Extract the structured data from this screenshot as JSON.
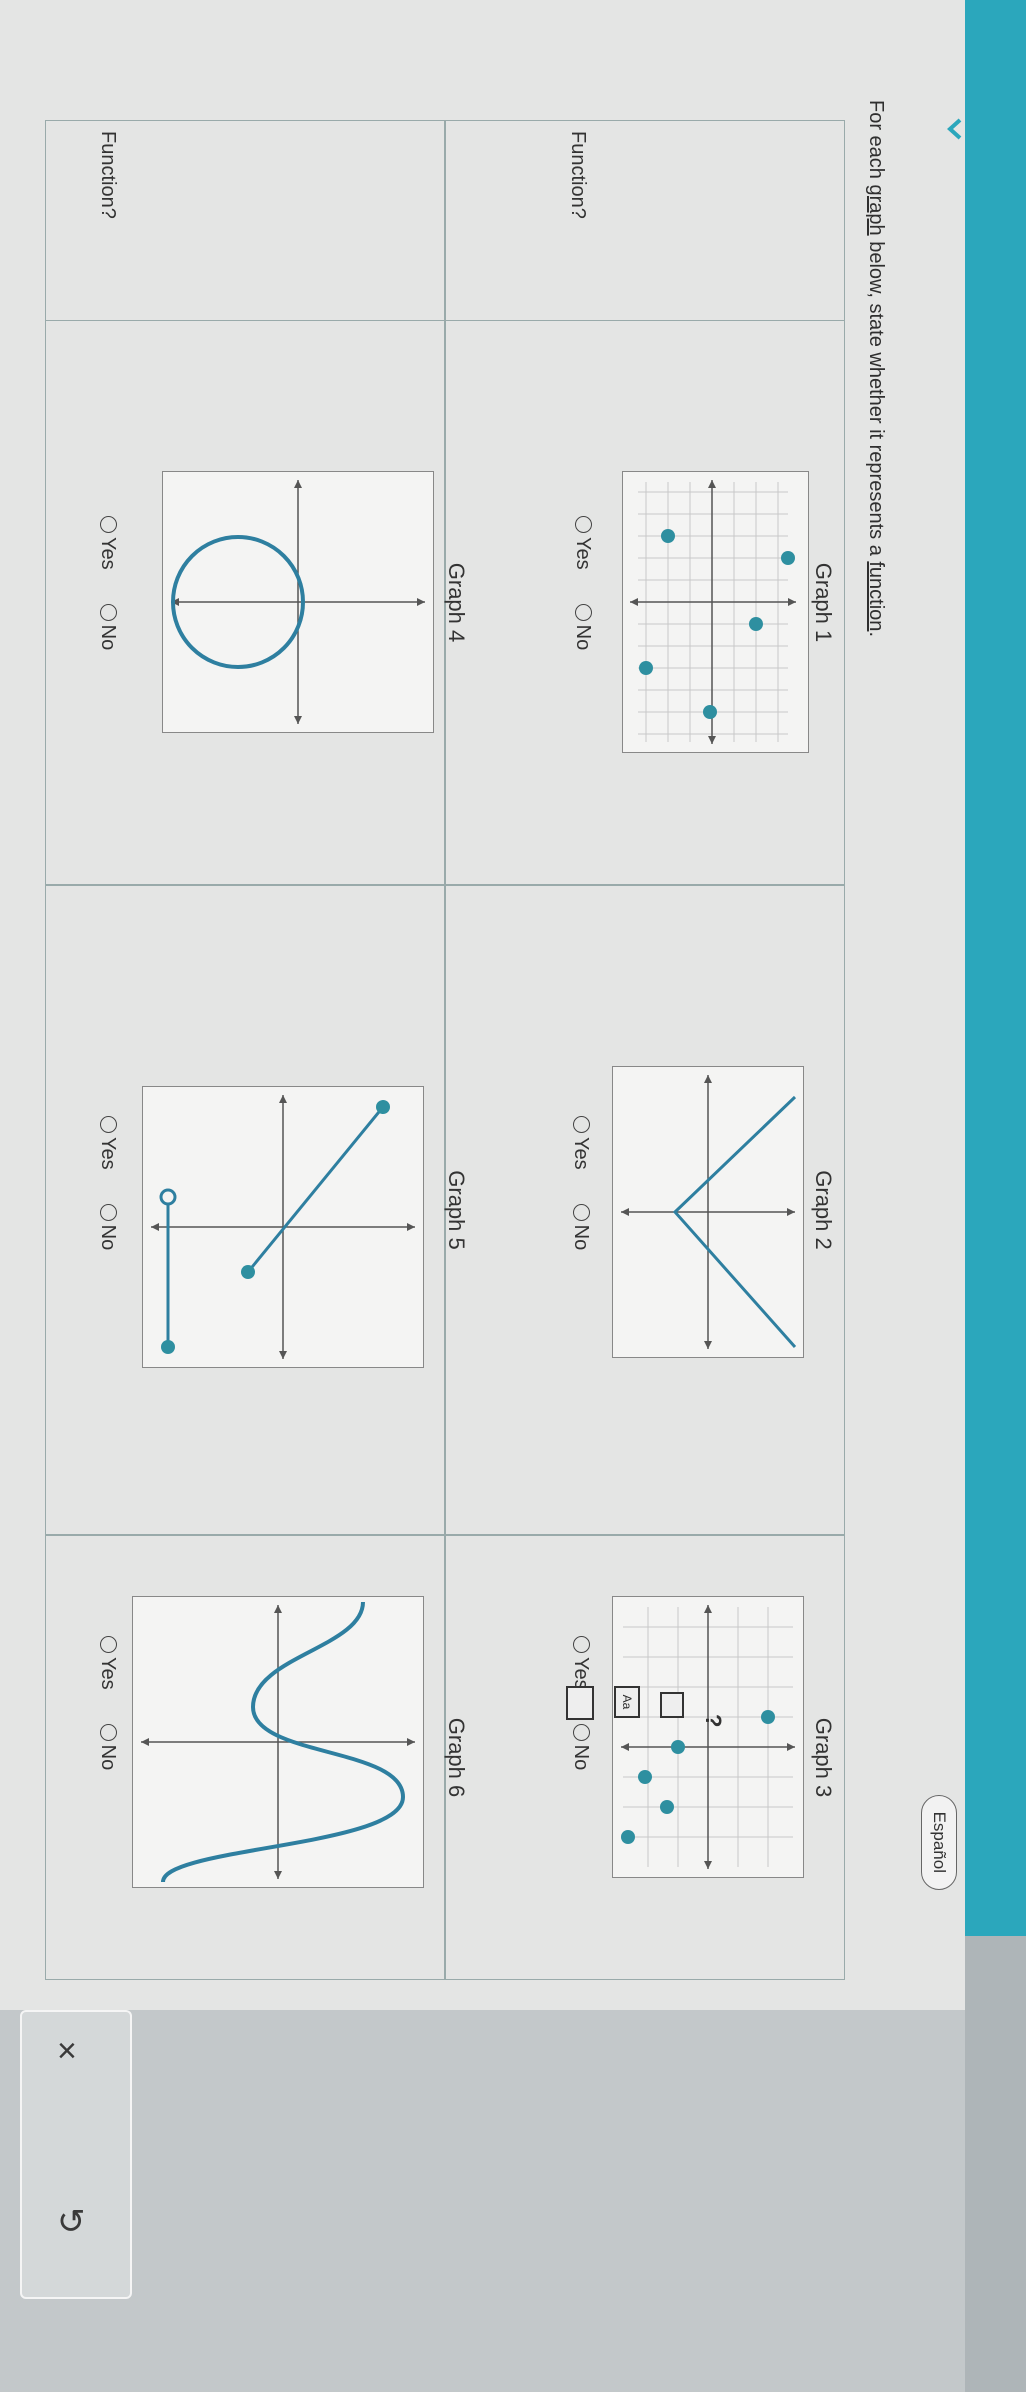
{
  "header": {
    "language_button": "Español"
  },
  "instructions": {
    "prefix": "For each ",
    "link1": "graph",
    "middle": " below, state whether it represents a ",
    "link2": "function",
    "suffix": "."
  },
  "row_label": "Function?",
  "options": {
    "yes": "Yes",
    "no": "No"
  },
  "graphs": [
    {
      "title": "Graph 1"
    },
    {
      "title": "Graph 2"
    },
    {
      "title": "Graph 3"
    },
    {
      "title": "Graph 4"
    },
    {
      "title": "Graph 5"
    },
    {
      "title": "Graph 6"
    }
  ],
  "tools": {
    "help": "?",
    "aa": "Aa"
  },
  "side_panel": {
    "close": "×",
    "undo": "↺"
  },
  "colors": {
    "accent": "#2ba7bc",
    "point": "#2e8fa0",
    "curve": "#2e7fa0"
  }
}
